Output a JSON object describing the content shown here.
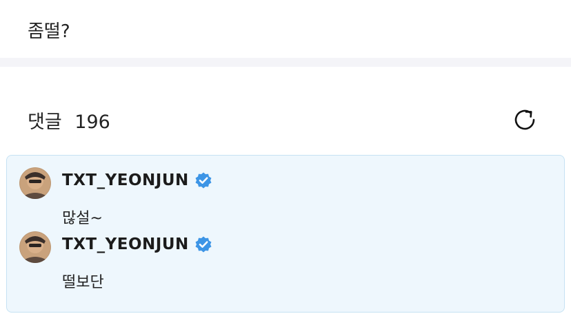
{
  "post": {
    "text": "좀떨?"
  },
  "comments_header": {
    "label": "댓글",
    "count": "196"
  },
  "icons": {
    "refresh": "refresh-icon",
    "verified": "verified-badge-icon"
  },
  "colors": {
    "highlight_bg": "#eef7fd",
    "highlight_border": "#c6e2f3",
    "verified": "#3d95e6"
  },
  "comments": [
    {
      "author": "TXT_YEONJUN",
      "verified": true,
      "text": "많설~"
    },
    {
      "author": "TXT_YEONJUN",
      "verified": true,
      "text": "떨보단"
    }
  ]
}
